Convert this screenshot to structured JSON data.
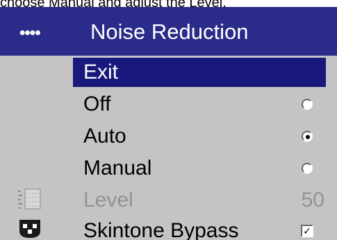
{
  "caption": "choose Manual and adjust the Level.",
  "menu": {
    "dots": "••••",
    "title": "Noise Reduction",
    "items": [
      {
        "label": "Exit"
      },
      {
        "label": "Off",
        "selected": false
      },
      {
        "label": "Auto",
        "selected": true
      },
      {
        "label": "Manual",
        "selected": false
      },
      {
        "label": "Level",
        "value": "50"
      },
      {
        "label": "Skintone Bypass",
        "checked": true,
        "check_glyph": "✓"
      }
    ]
  },
  "colors": {
    "title_bar": "#2b2b8a",
    "highlight": "#19197d",
    "panel": "#c6c3c6",
    "disabled_text": "#949294"
  },
  "icons": {
    "level": "level-icon",
    "skintone": "face-icon"
  }
}
